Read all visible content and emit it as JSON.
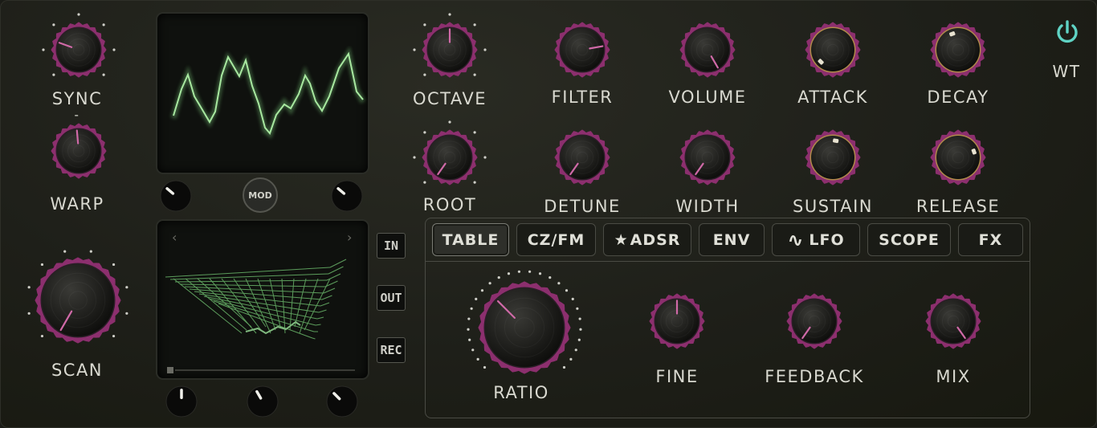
{
  "colors": {
    "accent": "#8c2f6e",
    "ring_gold": "#b08a4a",
    "screen_green": "#7fd07f",
    "power": "#5fd3c4",
    "label": "#d9d9d0"
  },
  "knobs_left": {
    "sync": "SYNC",
    "sync_dash": "-",
    "warp": "WARP",
    "scan": "SCAN"
  },
  "knobs_top": {
    "octave": "OCTAVE",
    "filter": "FILTER",
    "volume": "VOLUME",
    "attack": "ATTACK",
    "decay": "DECAY"
  },
  "knobs_mid": {
    "root": "ROOT",
    "detune": "DETUNE",
    "width": "WIDTH",
    "sustain": "SUSTAIN",
    "release": "RELEASE"
  },
  "power": {
    "icon": "power-icon",
    "label": "WT"
  },
  "mod_button": {
    "label": "MOD"
  },
  "io_buttons": {
    "in": "IN",
    "out": "OUT",
    "rec": "REC"
  },
  "table_nav": {
    "prev": "‹",
    "next": "›"
  },
  "tabs": {
    "table": "TABLE",
    "czfm": "CZ/FM",
    "adsr_star": "★",
    "adsr": "ADSR",
    "env": "ENV",
    "lfo_icon": "∿",
    "lfo": "LFO",
    "scope": "SCOPE",
    "fx": "FX"
  },
  "fm_section": {
    "ratio": "RATIO",
    "fine": "FINE",
    "feedback": "FEEDBACK",
    "mix": "MIX"
  }
}
